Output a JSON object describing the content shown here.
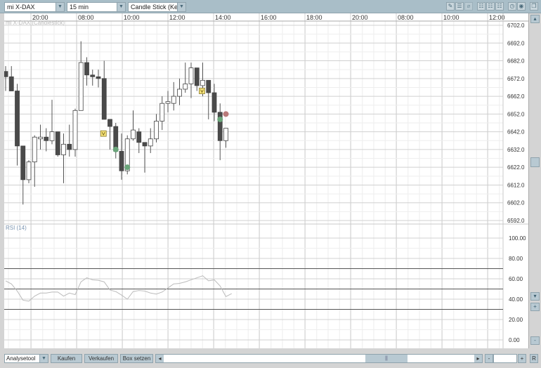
{
  "toolbar": {
    "instrument": "mi X-DAX",
    "interval": "15 min",
    "chart_type": "Candle Stick (Kerze",
    "icons": [
      "pencil-icon",
      "lines-icon",
      "eraser-icon",
      "grid-icon",
      "grid-icon",
      "grid-icon",
      "clock-icon",
      "globe-icon",
      "window-icon"
    ]
  },
  "chart_title": "mi X-DAX (Candlestick)",
  "time_labels": [
    "20:00",
    "08:00",
    "10:00",
    "12:00",
    "14:00",
    "16:00",
    "18:00",
    "20:00",
    "08:00",
    "10:00",
    "12:00"
  ],
  "price_axis": [
    "6702.0",
    "6692.0",
    "6682.0",
    "6672.0",
    "6662.0",
    "6652.0",
    "6642.0",
    "6632.0",
    "6622.0",
    "6612.0",
    "6602.0",
    "6592.0"
  ],
  "rsi": {
    "title": "RSI (14)",
    "axis": [
      "100.00",
      "80.00",
      "60.00",
      "40.00",
      "20.00",
      "0.00"
    ],
    "levels": [
      70,
      50,
      30
    ],
    "values": [
      58,
      55,
      48,
      39,
      38,
      43,
      46,
      46,
      47,
      47,
      43,
      46,
      44.5,
      57,
      61,
      59,
      58.5,
      57,
      49,
      47.5,
      44,
      40,
      47.5,
      48.5,
      48,
      46,
      45,
      47,
      51,
      55,
      55.5,
      57,
      59,
      61,
      63,
      58,
      59,
      53,
      42.5,
      45.5
    ]
  },
  "colors": {
    "up": "#ffffff",
    "down": "#4a4a4a",
    "buy_marker": "#6aa57a",
    "sell_marker": "#b97a7a",
    "signal_box": "#f5e27a"
  },
  "chart_data": {
    "type": "candlestick",
    "price_range": [
      6592,
      6702
    ],
    "candles": [
      [
        6676,
        6679,
        6665,
        6673
      ],
      [
        6673,
        6679,
        6665,
        6665
      ],
      [
        6665,
        6669,
        6623,
        6634
      ],
      [
        6634,
        6634,
        6601,
        6615
      ],
      [
        6615,
        6626,
        6613,
        6625
      ],
      [
        6625,
        6640,
        6611,
        6639
      ],
      [
        6638,
        6646,
        6632,
        6639
      ],
      [
        6639,
        6644,
        6631,
        6637
      ],
      [
        6637,
        6660,
        6635,
        6642
      ],
      [
        6642,
        6642,
        6628,
        6629
      ],
      [
        6629,
        6641,
        6613,
        6635
      ],
      [
        6635,
        6646,
        6628,
        6632
      ],
      [
        6632,
        6655,
        6628,
        6654
      ],
      [
        6654,
        6693,
        6654,
        6681
      ],
      [
        6681,
        6684,
        6668,
        6674
      ],
      [
        6674,
        6677,
        6668,
        6673
      ],
      [
        6673,
        6677,
        6667,
        6672
      ],
      [
        6672,
        6682,
        6649,
        6649
      ],
      [
        6649,
        6649,
        6632,
        6645
      ],
      [
        6645,
        6647,
        6627,
        6631
      ],
      [
        6631,
        6641,
        6615,
        6620
      ],
      [
        6620,
        6640,
        6618,
        6638
      ],
      [
        6638,
        6654,
        6637,
        6643
      ],
      [
        6642,
        6644,
        6630,
        6636
      ],
      [
        6636,
        6636,
        6619,
        6634
      ],
      [
        6634,
        6644,
        6630,
        6638
      ],
      [
        6638,
        6652,
        6636,
        6648
      ],
      [
        6648,
        6662,
        6643,
        6658
      ],
      [
        6658,
        6665,
        6653,
        6659
      ],
      [
        6658,
        6670,
        6654,
        6662
      ],
      [
        6662,
        6672,
        6657,
        6666
      ],
      [
        6666,
        6681,
        6664,
        6669
      ],
      [
        6669,
        6681,
        6661,
        6678
      ],
      [
        6678,
        6678,
        6665,
        6668
      ],
      [
        6668,
        6681,
        6662,
        6671
      ],
      [
        6671,
        6671,
        6649,
        6664
      ],
      [
        6664,
        6669,
        6648,
        6653
      ],
      [
        6653,
        6658,
        6626,
        6637
      ],
      [
        6637,
        6644,
        6633,
        6644
      ]
    ],
    "signals": [
      {
        "bar": 17,
        "type": "box",
        "price": 6641
      },
      {
        "bar": 34,
        "type": "box",
        "price": 6665
      },
      {
        "bar": 19,
        "type": "buy",
        "price": 6632
      },
      {
        "bar": 21,
        "type": "buy",
        "price": 6622
      },
      {
        "bar": 37,
        "type": "buy",
        "price": 6649
      },
      {
        "bar": 38,
        "type": "sell",
        "price": 6652
      }
    ]
  },
  "bottom": {
    "tool": "Analysetool",
    "buy": "Kaufen",
    "sell": "Verkaufen",
    "box": "Box setzen",
    "scroll_thumb": "||",
    "minus": "-",
    "plus": "+",
    "reset": "R",
    "left": "◂",
    "right": "▸"
  },
  "vscroll": {
    "up": "▴",
    "down": "▾",
    "plus": "+",
    "minus": "-"
  }
}
